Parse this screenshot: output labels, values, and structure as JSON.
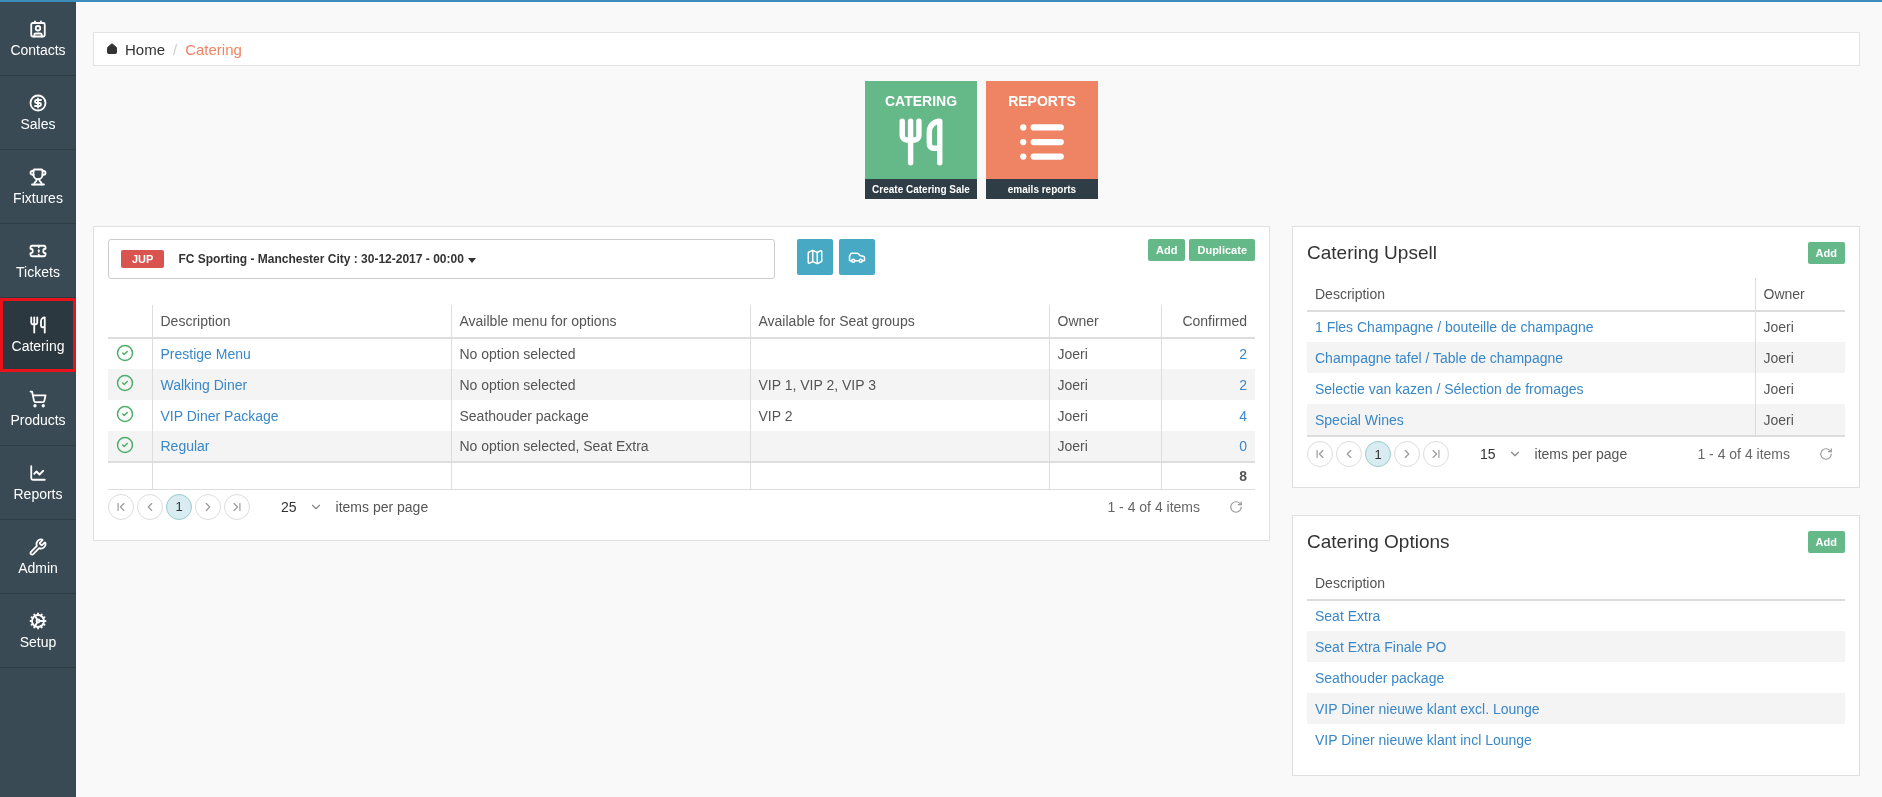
{
  "sidebar": {
    "items": [
      {
        "label": "Contacts",
        "selected": false
      },
      {
        "label": "Sales",
        "selected": false
      },
      {
        "label": "Fixtures",
        "selected": false
      },
      {
        "label": "Tickets",
        "selected": false
      },
      {
        "label": "Catering",
        "selected": true
      },
      {
        "label": "Products",
        "selected": false
      },
      {
        "label": "Reports",
        "selected": false
      },
      {
        "label": "Admin",
        "selected": false
      },
      {
        "label": "Setup",
        "selected": false
      }
    ]
  },
  "breadcrumb": [
    {
      "label": "Home",
      "kind": "home"
    },
    {
      "label": "/",
      "kind": "separator"
    },
    {
      "label": "Catering",
      "kind": "current"
    }
  ],
  "tiles": [
    {
      "title": "CATERING",
      "caption": "Create Catering Sale",
      "color": "#65b989",
      "kind": "cutlery"
    },
    {
      "title": "REPORTS",
      "caption": "emails reports",
      "color": "#ef8465",
      "kind": "list"
    }
  ],
  "fixture_panel": {
    "event_badge": "JUP",
    "event": "FC Sporting - Manchester City : 30-12-2017 - 00:00",
    "buttons": [
      "Add",
      "Duplicate"
    ],
    "columns": [
      "Description",
      "Availble menu for options",
      "Available for Seat groups",
      "Owner",
      "Confirmed"
    ],
    "rows": [
      {
        "confirmed_status": true,
        "cells": [
          "Prestige Menu",
          "No option selected",
          "",
          "Joeri",
          "2"
        ]
      },
      {
        "confirmed_status": true,
        "cells": [
          "Walking Diner",
          "No option selected",
          "VIP 1, VIP 2, VIP 3",
          "Joeri",
          "2"
        ]
      },
      {
        "confirmed_status": true,
        "cells": [
          "VIP Diner Package",
          "Seathouder package",
          "VIP 2",
          "Joeri",
          "4"
        ]
      },
      {
        "confirmed_status": true,
        "cells": [
          "Regular",
          "No option selected, Seat Extra",
          "",
          "Joeri",
          "0"
        ]
      }
    ],
    "total": "8",
    "pager": {
      "pages": [
        {
          "label": "1",
          "selected": true
        }
      ],
      "page_size": "25",
      "per_page_label": "items per page",
      "summary": "1 - 4 of 4 items"
    }
  },
  "upsell_panel": {
    "title": "Catering Upsell",
    "button": "Add",
    "columns": [
      "Description",
      "Owner"
    ],
    "rows": [
      [
        "1 Fles Champagne / bouteille de champagne",
        "Joeri"
      ],
      [
        "Champagne tafel / Table de champagne",
        "Joeri"
      ],
      [
        "Selectie van kazen / Sélection de fromages",
        "Joeri"
      ],
      [
        "Special Wines",
        "Joeri"
      ]
    ],
    "pager": {
      "pages": [
        {
          "label": "1",
          "selected": true
        }
      ],
      "page_size": "15",
      "per_page_label": "items per page",
      "summary": "1 - 4 of 4 items"
    }
  },
  "options_panel": {
    "title": "Catering Options",
    "button": "Add",
    "columns": [
      "Description"
    ],
    "rows": [
      [
        "Seat Extra"
      ],
      [
        "Seat Extra Finale PO"
      ],
      [
        "Seathouder package"
      ],
      [
        "VIP Diner nieuwe klant excl. Lounge"
      ],
      [
        "VIP Diner nieuwe klant incl Lounge"
      ]
    ]
  }
}
